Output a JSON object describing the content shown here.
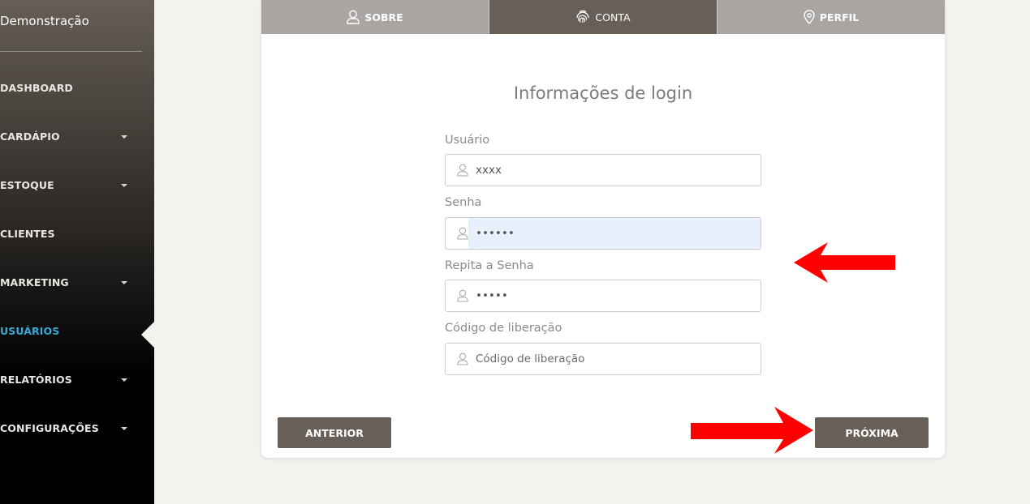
{
  "brand": "Demonstração",
  "nav": [
    {
      "label": "DASHBOARD",
      "caret": false
    },
    {
      "label": "CARDÁPIO",
      "caret": true
    },
    {
      "label": "ESTOQUE",
      "caret": true
    },
    {
      "label": "CLIENTES",
      "caret": false
    },
    {
      "label": "MARKETING",
      "caret": true
    },
    {
      "label": "USUÁRIOS",
      "caret": false,
      "active": true
    },
    {
      "label": "RELATÓRIOS",
      "caret": true
    },
    {
      "label": "CONFIGURAÇÕES",
      "caret": true
    }
  ],
  "tabs": [
    {
      "label": "SOBRE",
      "icon": "user-icon"
    },
    {
      "label": "CONTA",
      "icon": "fingerprint-icon",
      "active": true
    },
    {
      "label": "PERFIL",
      "icon": "map-pin-icon"
    }
  ],
  "form": {
    "title": "Informações de login",
    "usuario_label": "Usuário",
    "usuario_value": "xxxx",
    "senha_label": "Senha",
    "senha_value": "******",
    "repita_label": "Repita a Senha",
    "repita_value": "*****",
    "codigo_label": "Código de liberação",
    "codigo_placeholder": "Código de liberação"
  },
  "buttons": {
    "anterior": "ANTERIOR",
    "proxima": "PRÓXIMA"
  },
  "colors": {
    "active_nav": "#3aa9d8",
    "button": "#686058",
    "annotation_arrow": "#ff0000"
  }
}
